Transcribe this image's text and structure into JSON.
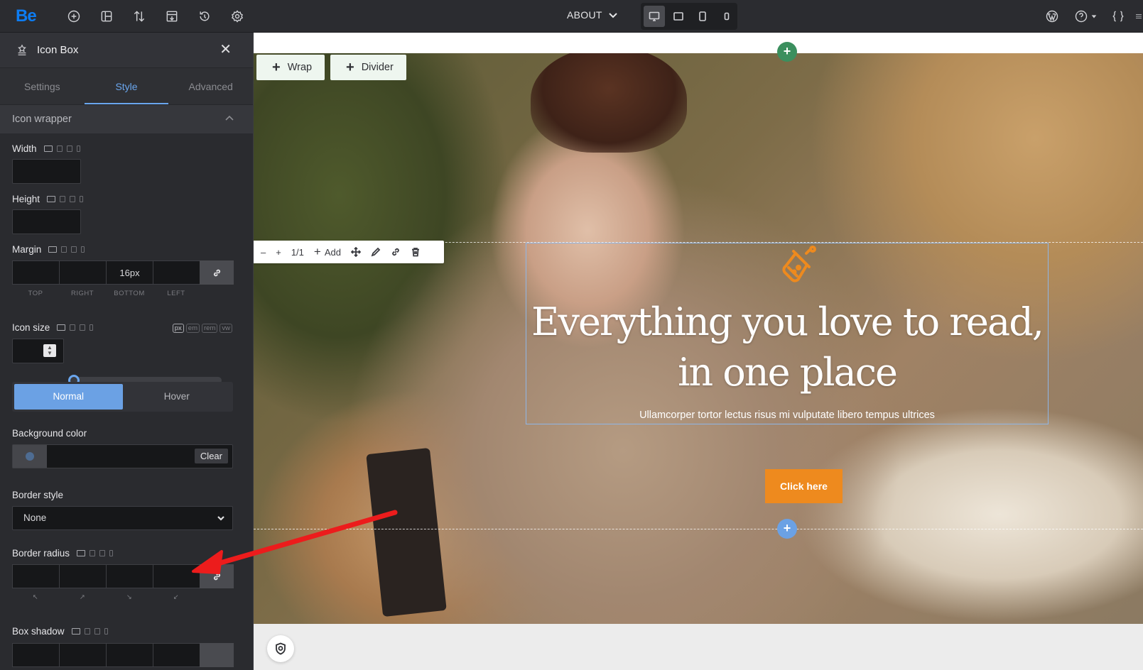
{
  "topbar": {
    "logo": "Be",
    "page_name": "ABOUT",
    "icons": [
      "add-circle-icon",
      "layout-icon",
      "sort-icon",
      "template-icon",
      "history-icon",
      "settings-icon"
    ],
    "devices": [
      "desktop-icon",
      "tablet-landscape-icon",
      "tablet-icon",
      "mobile-icon"
    ],
    "right_icons": [
      "wordpress-icon",
      "help-icon",
      "css-icon"
    ]
  },
  "sidebar": {
    "element_title": "Icon Box",
    "tabs": [
      {
        "label": "Settings",
        "active": false
      },
      {
        "label": "Style",
        "active": true
      },
      {
        "label": "Advanced",
        "active": false
      }
    ],
    "section_title": "Icon wrapper",
    "width_label": "Width",
    "height_label": "Height",
    "margin": {
      "label": "Margin",
      "values": [
        "",
        "",
        "16px",
        ""
      ],
      "sublabels": [
        "TOP",
        "RIGHT",
        "BOTTOM",
        "LEFT"
      ]
    },
    "icon_size": {
      "label": "Icon size",
      "units": [
        "px",
        "em",
        "rem",
        "vw"
      ],
      "active_unit": "px",
      "value": "",
      "slider_fraction": 0
    },
    "state_toggle": {
      "normal": "Normal",
      "hover": "Hover",
      "active": "Normal"
    },
    "background_color": {
      "label": "Background color",
      "clear": "Clear"
    },
    "border_style": {
      "label": "Border style",
      "value": "None"
    },
    "border_radius": {
      "label": "Border radius",
      "corner_marks": [
        "↖",
        "↗",
        "↘",
        "↙"
      ]
    },
    "box_shadow": {
      "label": "Box shadow"
    }
  },
  "canvas": {
    "wrap_button": "Wrap",
    "divider_button": "Divider",
    "element_toolbar": {
      "counter": "1/1",
      "add": "Add"
    },
    "hero": {
      "title_line1": "Everything you love to read,",
      "title_line2": "in one place",
      "subtitle": "Ullamcorper tortor lectus risus mi vulputate libero tempus ultrices",
      "cta": "Click here"
    },
    "accent_color": "#ee8a1e",
    "selection_color": "#8fb6e6",
    "add_section_color": "#3b8f5e",
    "add_element_color": "#6ba1e4"
  }
}
